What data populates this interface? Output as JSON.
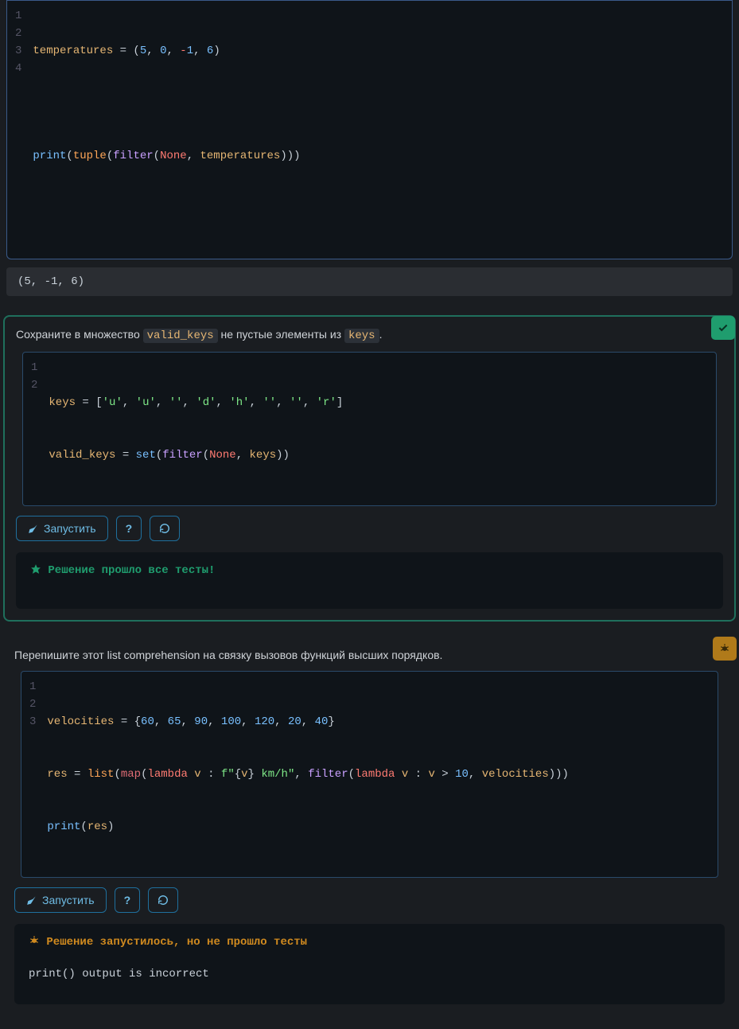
{
  "block0": {
    "gutter": [
      "1",
      "2",
      "3",
      "4"
    ],
    "code": {
      "l1": {
        "a": "temperatures ",
        "b": "=",
        "c": " (",
        "d": "5",
        "e": ", ",
        "f": "0",
        "g": ", ",
        "h": "-",
        "i": "1",
        "j": ", ",
        "k": "6",
        "l": ")"
      },
      "l3": {
        "a": "print",
        "b": "(",
        "c": "tuple",
        "d": "(",
        "e": "filter",
        "f": "(",
        "g": "None",
        "h": ", ",
        "i": "temperatures",
        "j": ")))"
      }
    },
    "output": "(5, -1, 6)"
  },
  "block1": {
    "desc_a": "Сохраните в множество ",
    "desc_b": "valid_keys",
    "desc_c": " не пустые элементы из ",
    "desc_d": "keys",
    "desc_e": ".",
    "gutter": [
      "1",
      "2"
    ],
    "code": {
      "l1": {
        "a": "keys ",
        "b": "=",
        "c": " [",
        "d": "'u'",
        "e": ", ",
        "f": "'u'",
        "g": ", ",
        "h": "''",
        "i": ", ",
        "j": "'d'",
        "k": ", ",
        "l": "'h'",
        "m": ", ",
        "n": "''",
        "o": ", ",
        "p": "''",
        "q": ", ",
        "r": "'r'",
        "s": "]"
      },
      "l2": {
        "a": "valid_keys ",
        "b": "=",
        "c": " ",
        "d": "set",
        "e": "(",
        "f": "filter",
        "g": "(",
        "h": "None",
        "i": ", ",
        "j": "keys",
        "k": "))"
      }
    },
    "run_label": "Запустить",
    "result": " Решение прошло все тесты!"
  },
  "block2": {
    "desc": "Перепишите этот list comprehension на связку вызовов функций высших порядков.",
    "gutter": [
      "1",
      "2",
      "3"
    ],
    "code": {
      "l1": {
        "a": "velocities ",
        "b": "=",
        "c": " {",
        "d": "60",
        "e": ", ",
        "f": "65",
        "g": ", ",
        "h": "90",
        "i": ", ",
        "j": "100",
        "k": ", ",
        "l": "120",
        "m": ", ",
        "n": "20",
        "o": ", ",
        "p": "40",
        "q": "}"
      },
      "l2": {
        "a": "res ",
        "b": "=",
        "c": " ",
        "d": "list",
        "e": "(",
        "f": "map",
        "g": "(",
        "h": "lambda",
        "i": " ",
        "j": "v",
        "k": " : ",
        "l": "f\"",
        "m": "{",
        "n": "v",
        "o": "}",
        "p": " km/h\"",
        "q": ", ",
        "r": "filter",
        "s": "(",
        "t": "lambda",
        "u": " ",
        "v": "v",
        "w": " : ",
        "x": "v",
        "y": " > ",
        "z": "10",
        "aa": ", ",
        "ab": "velocities",
        "ac": ")))"
      },
      "l3": {
        "a": "print",
        "b": "(",
        "c": "res",
        "d": ")"
      }
    },
    "run_label": "Запустить",
    "result": " Решение запустилось, но не прошло тесты",
    "result_detail": "print() output is incorrect"
  }
}
